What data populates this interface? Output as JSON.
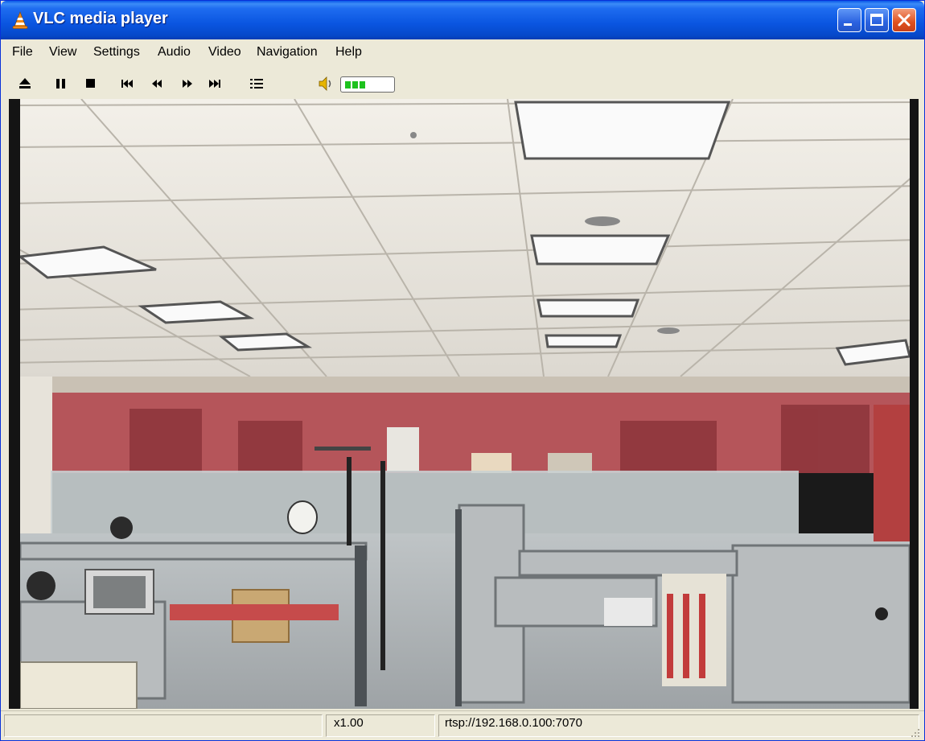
{
  "window": {
    "title": "VLC media player"
  },
  "menu": {
    "items": [
      "File",
      "View",
      "Settings",
      "Audio",
      "Video",
      "Navigation",
      "Help"
    ]
  },
  "toolbar": {
    "buttons": [
      "eject-icon",
      "pause-icon",
      "stop-icon",
      "skip-previous-icon",
      "rewind-icon",
      "fast-forward-icon",
      "skip-next-icon",
      "playlist-icon"
    ],
    "volume_icon": "speaker-icon",
    "volume_level": 0.375,
    "volume_color": "#1ec21e"
  },
  "status": {
    "speed": "x1.00",
    "stream": "rtsp://192.168.0.100:7070"
  },
  "colors": {
    "titlebar": "#0a55e0",
    "chrome": "#ece9d8",
    "close_button": "#e0511e"
  }
}
